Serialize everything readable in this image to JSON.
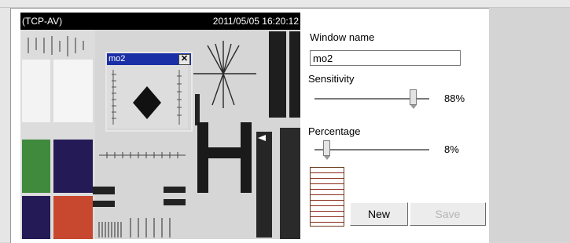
{
  "video": {
    "source_label": "(TCP-AV)",
    "timestamp": "2011/05/05 16:20:12"
  },
  "motion_window": {
    "title": "mo2",
    "close_glyph": "✕"
  },
  "settings": {
    "window_name_label": "Window name",
    "window_name_value": "mo2",
    "sensitivity_label": "Sensitivity",
    "sensitivity_value": 88,
    "sensitivity_text": "88%",
    "percentage_label": "Percentage",
    "percentage_value": 8,
    "percentage_text": "8%",
    "level_fraction": 0.0
  },
  "buttons": {
    "new_label": "New",
    "save_label": "Save"
  },
  "colors": {
    "window_title_bar": "#1a2fa6",
    "level_lines": "#8a2a1a"
  }
}
